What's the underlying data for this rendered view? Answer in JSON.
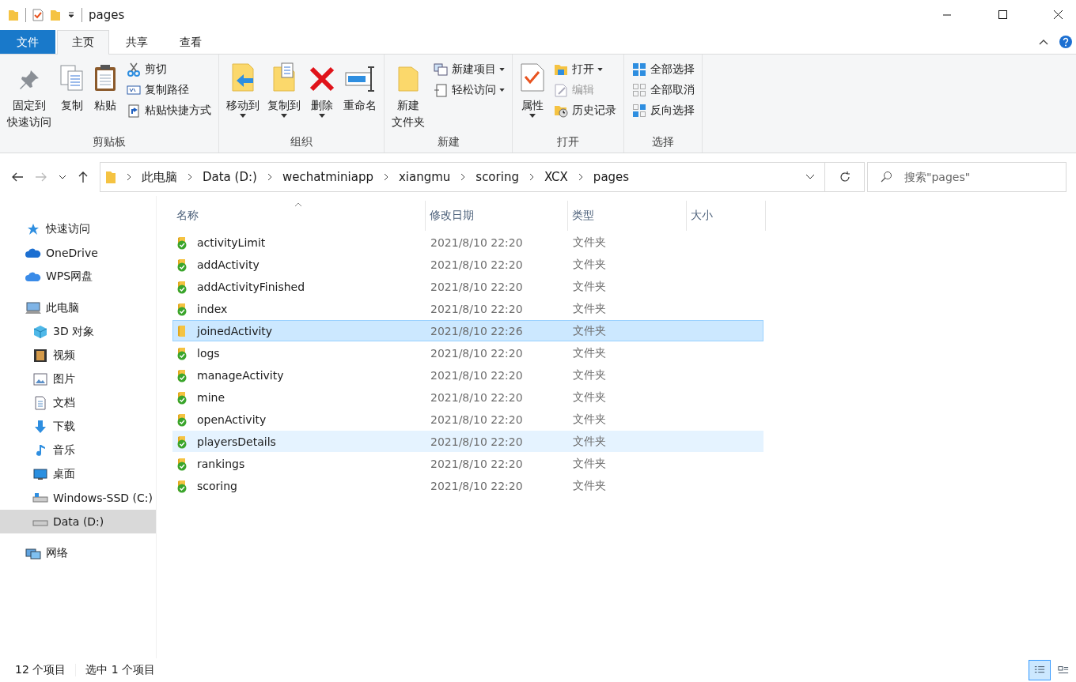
{
  "window": {
    "title": "pages"
  },
  "ribbon_tabs": [
    {
      "label": "文件",
      "kind": "file",
      "selected": false
    },
    {
      "label": "主页",
      "kind": "tab",
      "selected": true
    },
    {
      "label": "共享",
      "kind": "tab",
      "selected": false
    },
    {
      "label": "查看",
      "kind": "tab",
      "selected": false
    }
  ],
  "ribbon_groups": [
    {
      "label": "剪贴板",
      "items": [
        {
          "kind": "large",
          "lines": [
            "固定到",
            "快速访问"
          ],
          "dropdown": false
        },
        {
          "kind": "large",
          "lines": [
            "复制"
          ],
          "dropdown": false
        },
        {
          "kind": "large",
          "lines": [
            "粘贴"
          ],
          "dropdown": false
        },
        {
          "kind": "stack",
          "items": [
            {
              "label": "剪切",
              "dropdown": false,
              "disabled": false
            },
            {
              "label": "复制路径",
              "dropdown": false,
              "disabled": false
            },
            {
              "label": "粘贴快捷方式",
              "dropdown": false,
              "disabled": false
            }
          ]
        }
      ]
    },
    {
      "label": "组织",
      "items": [
        {
          "kind": "large",
          "lines": [
            "移动到"
          ],
          "dropdown": true
        },
        {
          "kind": "large",
          "lines": [
            "复制到"
          ],
          "dropdown": true
        },
        {
          "kind": "large",
          "lines": [
            "删除"
          ],
          "dropdown": true
        },
        {
          "kind": "large",
          "lines": [
            "重命名"
          ],
          "dropdown": false
        }
      ]
    },
    {
      "label": "新建",
      "items": [
        {
          "kind": "large",
          "lines": [
            "新建",
            "文件夹"
          ],
          "dropdown": false
        },
        {
          "kind": "stack",
          "items": [
            {
              "label": "新建项目",
              "dropdown": true,
              "disabled": false
            },
            {
              "label": "轻松访问",
              "dropdown": true,
              "disabled": false
            }
          ]
        }
      ]
    },
    {
      "label": "打开",
      "items": [
        {
          "kind": "large",
          "lines": [
            "属性"
          ],
          "dropdown": true
        },
        {
          "kind": "stack",
          "items": [
            {
              "label": "打开",
              "dropdown": true,
              "disabled": false
            },
            {
              "label": "编辑",
              "dropdown": false,
              "disabled": true
            },
            {
              "label": "历史记录",
              "dropdown": false,
              "disabled": false
            }
          ]
        }
      ]
    },
    {
      "label": "选择",
      "items": [
        {
          "kind": "stack",
          "items": [
            {
              "label": "全部选择",
              "dropdown": false,
              "disabled": false
            },
            {
              "label": "全部取消",
              "dropdown": false,
              "disabled": false
            },
            {
              "label": "反向选择",
              "dropdown": false,
              "disabled": false
            }
          ]
        }
      ]
    }
  ],
  "address": {
    "crumbs": [
      "此电脑",
      "Data (D:)",
      "wechatminiapp",
      "xiangmu",
      "scoring",
      "XCX",
      "pages"
    ]
  },
  "search": {
    "placeholder": "搜索\"pages\""
  },
  "sidebar": [
    {
      "label": "快速访问",
      "selected": false
    },
    {
      "label": "OneDrive",
      "selected": false
    },
    {
      "label": "WPS网盘",
      "selected": false
    },
    {
      "label": "此电脑",
      "selected": false,
      "children": [
        {
          "label": "3D 对象",
          "selected": false
        },
        {
          "label": "视频",
          "selected": false
        },
        {
          "label": "图片",
          "selected": false
        },
        {
          "label": "文档",
          "selected": false
        },
        {
          "label": "下载",
          "selected": false
        },
        {
          "label": "音乐",
          "selected": false
        },
        {
          "label": "桌面",
          "selected": false
        },
        {
          "label": "Windows-SSD (C:)",
          "selected": false
        },
        {
          "label": "Data (D:)",
          "selected": true
        }
      ]
    },
    {
      "label": "网络",
      "selected": false
    }
  ],
  "table": {
    "columns": [
      {
        "label": "名称",
        "sorted": true
      },
      {
        "label": "修改日期",
        "sorted": false
      },
      {
        "label": "类型",
        "sorted": false
      },
      {
        "label": "大小",
        "sorted": false
      }
    ],
    "rows": [
      {
        "name": "activityLimit",
        "modified": "2021/8/10 22:20",
        "type": "文件夹",
        "synced": true,
        "selected": false,
        "hovered": false
      },
      {
        "name": "addActivity",
        "modified": "2021/8/10 22:20",
        "type": "文件夹",
        "synced": true,
        "selected": false,
        "hovered": false
      },
      {
        "name": "addActivityFinished",
        "modified": "2021/8/10 22:20",
        "type": "文件夹",
        "synced": true,
        "selected": false,
        "hovered": false
      },
      {
        "name": "index",
        "modified": "2021/8/10 22:20",
        "type": "文件夹",
        "synced": true,
        "selected": false,
        "hovered": false
      },
      {
        "name": "joinedActivity",
        "modified": "2021/8/10 22:26",
        "type": "文件夹",
        "synced": false,
        "selected": true,
        "hovered": false
      },
      {
        "name": "logs",
        "modified": "2021/8/10 22:20",
        "type": "文件夹",
        "synced": true,
        "selected": false,
        "hovered": false
      },
      {
        "name": "manageActivity",
        "modified": "2021/8/10 22:20",
        "type": "文件夹",
        "synced": true,
        "selected": false,
        "hovered": false
      },
      {
        "name": "mine",
        "modified": "2021/8/10 22:20",
        "type": "文件夹",
        "synced": true,
        "selected": false,
        "hovered": false
      },
      {
        "name": "openActivity",
        "modified": "2021/8/10 22:20",
        "type": "文件夹",
        "synced": true,
        "selected": false,
        "hovered": false
      },
      {
        "name": "playersDetails",
        "modified": "2021/8/10 22:20",
        "type": "文件夹",
        "synced": true,
        "selected": false,
        "hovered": true
      },
      {
        "name": "rankings",
        "modified": "2021/8/10 22:20",
        "type": "文件夹",
        "synced": true,
        "selected": false,
        "hovered": false
      },
      {
        "name": "scoring",
        "modified": "2021/8/10 22:20",
        "type": "文件夹",
        "synced": true,
        "selected": false,
        "hovered": false
      }
    ]
  },
  "status_bar": {
    "count": "12 个项目",
    "selection": "选中 1 个项目"
  },
  "view_modes": [
    {
      "kind": "details",
      "selected": true
    },
    {
      "kind": "tiles",
      "selected": false
    }
  ]
}
